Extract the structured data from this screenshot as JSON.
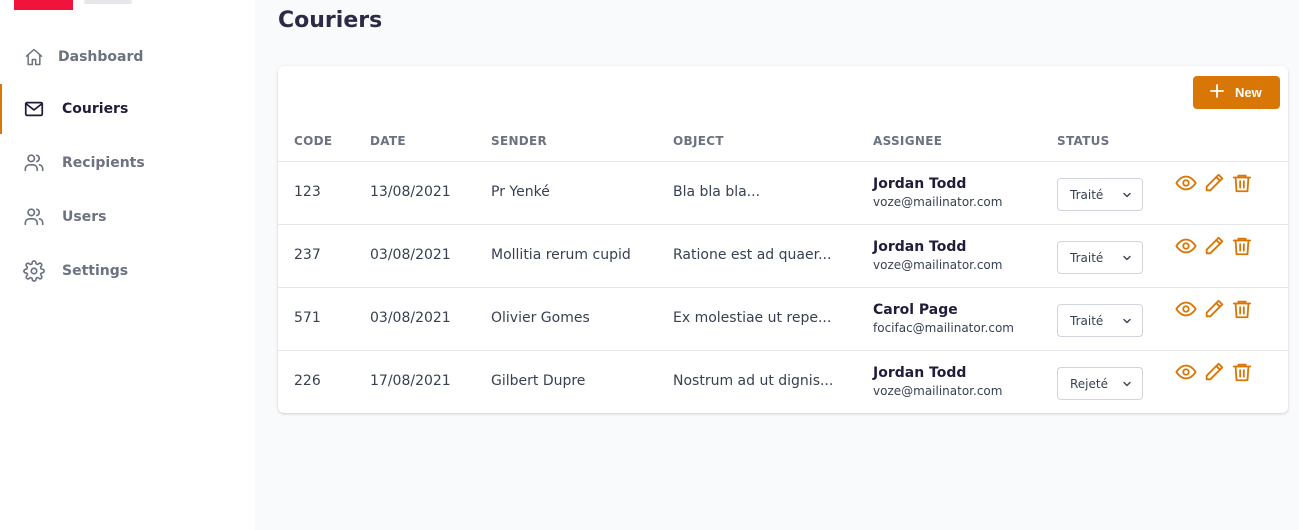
{
  "sidebar": {
    "items": [
      {
        "label": "Dashboard",
        "icon": "home-icon"
      },
      {
        "label": "Couriers",
        "icon": "mail-icon",
        "active": true
      },
      {
        "label": "Recipients",
        "icon": "users-icon"
      },
      {
        "label": "Users",
        "icon": "users-icon"
      },
      {
        "label": "Settings",
        "icon": "gear-icon"
      }
    ]
  },
  "page": {
    "title": "Couriers"
  },
  "toolbar": {
    "new_label": "New"
  },
  "table": {
    "headers": [
      "CODE",
      "DATE",
      "SENDER",
      "OBJECT",
      "ASSIGNEE",
      "STATUS"
    ],
    "rows": [
      {
        "code": "123",
        "date": "13/08/2021",
        "sender": "Pr Yenké",
        "object": "Bla bla bla...",
        "assignee_name": "Jordan Todd",
        "assignee_email": "voze@mailinator.com",
        "status": "Traité"
      },
      {
        "code": "237",
        "date": "03/08/2021",
        "sender": "Mollitia rerum cupid",
        "object": "Ratione est ad quaer...",
        "assignee_name": "Jordan Todd",
        "assignee_email": "voze@mailinator.com",
        "status": "Traité"
      },
      {
        "code": "571",
        "date": "03/08/2021",
        "sender": "Olivier Gomes",
        "object": "Ex molestiae ut repe...",
        "assignee_name": "Carol Page",
        "assignee_email": "focifac@mailinator.com",
        "status": "Traité"
      },
      {
        "code": "226",
        "date": "17/08/2021",
        "sender": "Gilbert Dupre",
        "object": "Nostrum ad ut dignis...",
        "assignee_name": "Jordan Todd",
        "assignee_email": "voze@mailinator.com",
        "status": "Rejeté"
      }
    ]
  },
  "colors": {
    "accent": "#d97706",
    "logo": "#f0143c"
  }
}
